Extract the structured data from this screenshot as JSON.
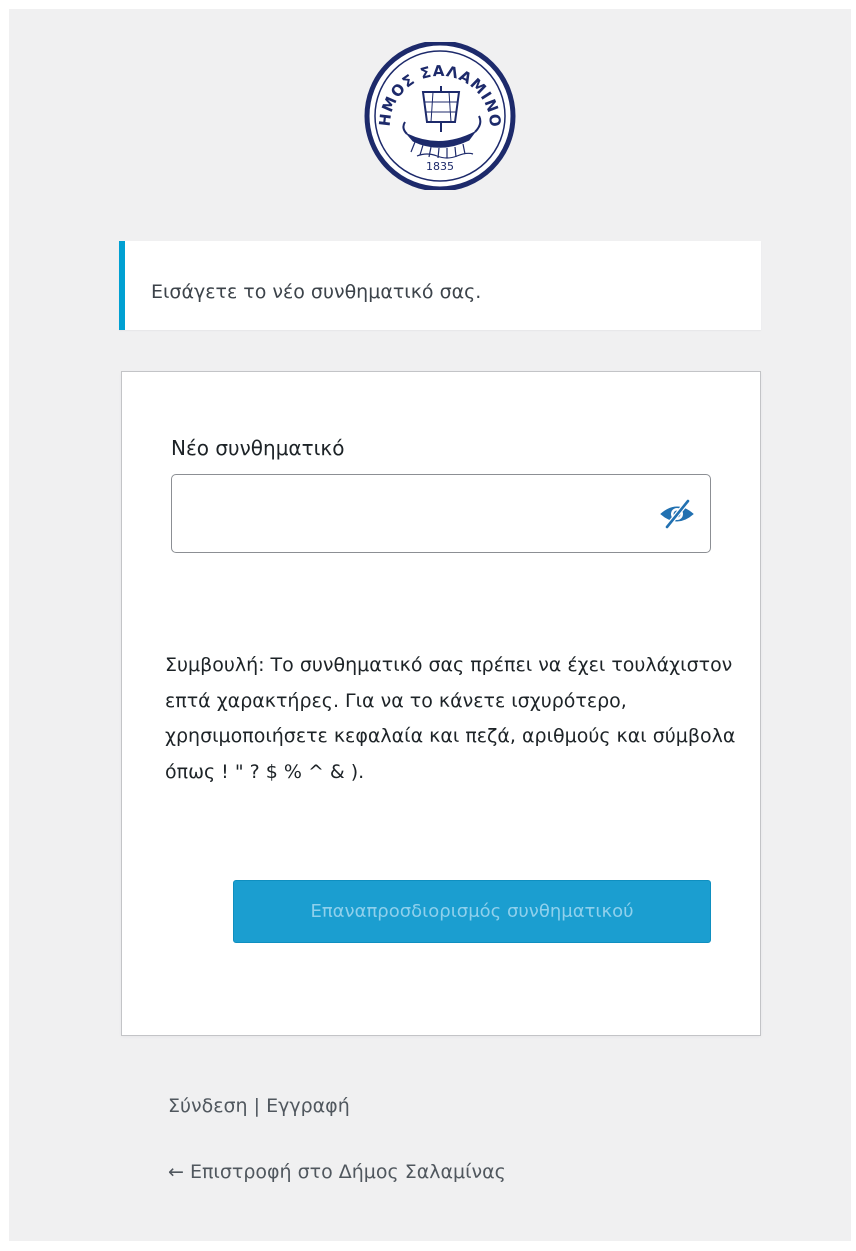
{
  "logo": {
    "brand_text": "ΔΗΜΟΣ ΣΑΛΑΜΙΝΟΣ",
    "year": "1835",
    "brand_color": "#1d2a6b"
  },
  "notice": {
    "message": "Εισάγετε το νέο συνθηματικό σας."
  },
  "form": {
    "password_label": "Νέο συνθηματικό",
    "password_value": "",
    "toggle_icon": "eye-slash-icon",
    "hint": "Συμβουλή: Το συνθηματικό σας πρέπει να έχει τουλάχιστον επτά χαρακτήρες. Για να το κάνετε ισχυρότερο, χρησιμοποιήσετε κεφαλαία και πεζά, αριθμούς και σύμβολα όπως ! \" ? $ % ^ & ).",
    "submit_label": "Επαναπροσδιορισμός συνθηματικού"
  },
  "footer": {
    "login_label": "Σύνδεση",
    "separator": "|",
    "register_label": "Εγγραφή",
    "back_label": "← Επιστροφή στο Δήμος Σαλαμίνας"
  },
  "colors": {
    "accent": "#00a0d2",
    "button": "#1b9ed0",
    "background": "#f0f0f1"
  }
}
